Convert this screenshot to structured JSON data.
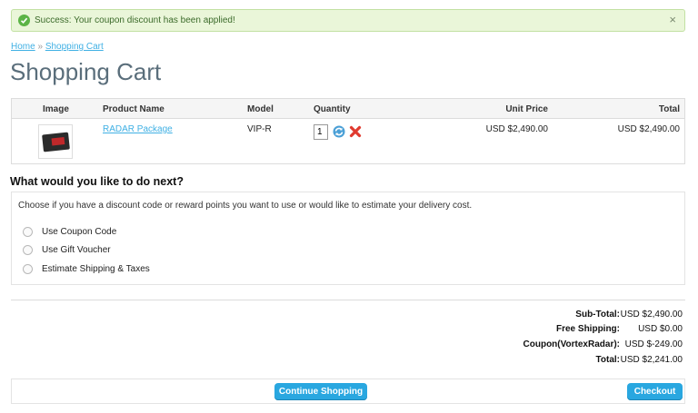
{
  "alert": {
    "message": "Success: Your coupon discount has been applied!",
    "close": "×",
    "color": "#eaf6d9"
  },
  "breadcrumb": {
    "home": "Home",
    "separator": "»",
    "current": "Shopping Cart"
  },
  "page_title": "Shopping Cart",
  "cart": {
    "columns": [
      "Image",
      "Product Name",
      "Model",
      "Quantity",
      "Unit Price",
      "Total"
    ],
    "rows": [
      {
        "name": "RADAR Package",
        "model": "VIP-R",
        "quantity": "1",
        "unit_price": "USD $2,490.00",
        "total": "USD $2,490.00",
        "update_icon": "refresh-icon",
        "remove_icon": "remove-icon"
      }
    ]
  },
  "next": {
    "title": "What would you like to do next?",
    "description": "Choose if you have a discount code or reward points you want to use or would like to estimate your delivery cost.",
    "options": [
      "Use Coupon Code",
      "Use Gift Voucher",
      "Estimate Shipping & Taxes"
    ]
  },
  "totals": [
    {
      "label": "Sub-Total:",
      "value": "USD $2,490.00"
    },
    {
      "label": "Free Shipping:",
      "value": "USD $0.00"
    },
    {
      "label": "Coupon(VortexRadar):",
      "value": "USD $-249.00"
    },
    {
      "label": "Total:",
      "value": "USD $2,241.00"
    }
  ],
  "buttons": {
    "continue": "Continue Shopping",
    "checkout": "Checkout"
  },
  "colors": {
    "accent": "#29a7e0",
    "link": "#3fb0e4",
    "success": "#5cb447",
    "remove": "#e03a2f"
  }
}
